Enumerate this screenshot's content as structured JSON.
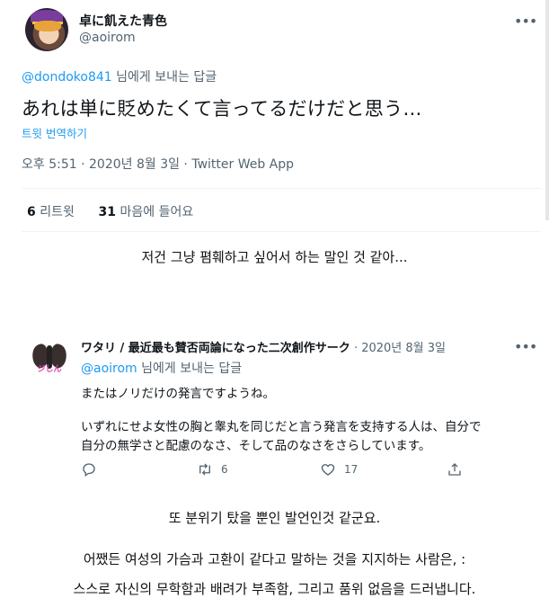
{
  "tweet": {
    "author_name": "卓に飢えた青色",
    "author_handle": "@aoirom",
    "reply_to_handle": "@dondoko841",
    "reply_to_suffix": " 님에게 보내는 답글",
    "text": "あれは単に貶めたくて言ってるだけだと思う…",
    "translate_label": "트윗 번역하기",
    "meta": "오후 5:51 · 2020년 8월 3일 · Twitter Web App",
    "retweets_count": "6",
    "retweets_label": " 리트윗",
    "likes_count": "31",
    "likes_label": " 마음에 들어요"
  },
  "translation_1": "저건 그냥 폄훼하고 싶어서 하는 말인 것 같아...",
  "reply": {
    "author_name": "ワタリ / 最近最も賛否両論になった二次創作サーク",
    "date": " · 2020년 8월 3일",
    "avatar_logo_text": "ジしん",
    "reply_to_handle": "@aoirom",
    "reply_to_suffix": " 님에게 보내는 답글",
    "line1": "またはノリだけの発言ですようね。",
    "line2": "いずれにせよ女性の胸と睾丸を同じだと言う発言を支持する人は、自分で",
    "line3": "自分の無学さと配慮のなさ、そして品のなさをさらしています。",
    "retweets_count": "6",
    "likes_count": "17"
  },
  "translation_2": {
    "line1": "또 분위기 탔을 뿐인 발언인것 같군요.",
    "line2": "어쨌든 여성의 가슴과 고환이 같다고 말하는 것을 지지하는 사람은, :",
    "line3": "스스로 자신의 무학함과 배려가 부족함, 그리고 품위 없음을 드러냅니다."
  },
  "icons": [
    "more-icon",
    "reply-icon",
    "retweet-icon",
    "like-icon",
    "share-icon"
  ],
  "colors": {
    "link": "#1d9bf0",
    "muted": "#536471",
    "text": "#0f1419"
  }
}
